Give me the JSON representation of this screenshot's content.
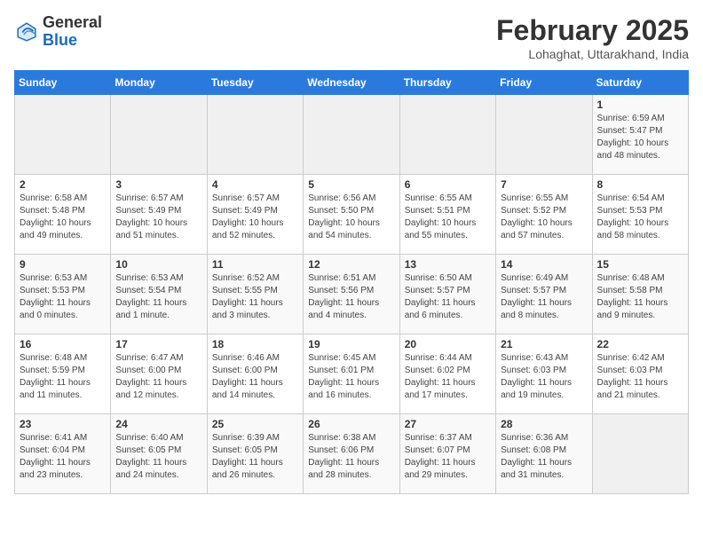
{
  "header": {
    "logo_line1": "General",
    "logo_line2": "Blue",
    "title": "February 2025",
    "subtitle": "Lohaghat, Uttarakhand, India"
  },
  "weekdays": [
    "Sunday",
    "Monday",
    "Tuesday",
    "Wednesday",
    "Thursday",
    "Friday",
    "Saturday"
  ],
  "weeks": [
    [
      {
        "day": "",
        "info": ""
      },
      {
        "day": "",
        "info": ""
      },
      {
        "day": "",
        "info": ""
      },
      {
        "day": "",
        "info": ""
      },
      {
        "day": "",
        "info": ""
      },
      {
        "day": "",
        "info": ""
      },
      {
        "day": "1",
        "info": "Sunrise: 6:59 AM\nSunset: 5:47 PM\nDaylight: 10 hours\nand 48 minutes."
      }
    ],
    [
      {
        "day": "2",
        "info": "Sunrise: 6:58 AM\nSunset: 5:48 PM\nDaylight: 10 hours\nand 49 minutes."
      },
      {
        "day": "3",
        "info": "Sunrise: 6:57 AM\nSunset: 5:49 PM\nDaylight: 10 hours\nand 51 minutes."
      },
      {
        "day": "4",
        "info": "Sunrise: 6:57 AM\nSunset: 5:49 PM\nDaylight: 10 hours\nand 52 minutes."
      },
      {
        "day": "5",
        "info": "Sunrise: 6:56 AM\nSunset: 5:50 PM\nDaylight: 10 hours\nand 54 minutes."
      },
      {
        "day": "6",
        "info": "Sunrise: 6:55 AM\nSunset: 5:51 PM\nDaylight: 10 hours\nand 55 minutes."
      },
      {
        "day": "7",
        "info": "Sunrise: 6:55 AM\nSunset: 5:52 PM\nDaylight: 10 hours\nand 57 minutes."
      },
      {
        "day": "8",
        "info": "Sunrise: 6:54 AM\nSunset: 5:53 PM\nDaylight: 10 hours\nand 58 minutes."
      }
    ],
    [
      {
        "day": "9",
        "info": "Sunrise: 6:53 AM\nSunset: 5:53 PM\nDaylight: 11 hours\nand 0 minutes."
      },
      {
        "day": "10",
        "info": "Sunrise: 6:53 AM\nSunset: 5:54 PM\nDaylight: 11 hours\nand 1 minute."
      },
      {
        "day": "11",
        "info": "Sunrise: 6:52 AM\nSunset: 5:55 PM\nDaylight: 11 hours\nand 3 minutes."
      },
      {
        "day": "12",
        "info": "Sunrise: 6:51 AM\nSunset: 5:56 PM\nDaylight: 11 hours\nand 4 minutes."
      },
      {
        "day": "13",
        "info": "Sunrise: 6:50 AM\nSunset: 5:57 PM\nDaylight: 11 hours\nand 6 minutes."
      },
      {
        "day": "14",
        "info": "Sunrise: 6:49 AM\nSunset: 5:57 PM\nDaylight: 11 hours\nand 8 minutes."
      },
      {
        "day": "15",
        "info": "Sunrise: 6:48 AM\nSunset: 5:58 PM\nDaylight: 11 hours\nand 9 minutes."
      }
    ],
    [
      {
        "day": "16",
        "info": "Sunrise: 6:48 AM\nSunset: 5:59 PM\nDaylight: 11 hours\nand 11 minutes."
      },
      {
        "day": "17",
        "info": "Sunrise: 6:47 AM\nSunset: 6:00 PM\nDaylight: 11 hours\nand 12 minutes."
      },
      {
        "day": "18",
        "info": "Sunrise: 6:46 AM\nSunset: 6:00 PM\nDaylight: 11 hours\nand 14 minutes."
      },
      {
        "day": "19",
        "info": "Sunrise: 6:45 AM\nSunset: 6:01 PM\nDaylight: 11 hours\nand 16 minutes."
      },
      {
        "day": "20",
        "info": "Sunrise: 6:44 AM\nSunset: 6:02 PM\nDaylight: 11 hours\nand 17 minutes."
      },
      {
        "day": "21",
        "info": "Sunrise: 6:43 AM\nSunset: 6:03 PM\nDaylight: 11 hours\nand 19 minutes."
      },
      {
        "day": "22",
        "info": "Sunrise: 6:42 AM\nSunset: 6:03 PM\nDaylight: 11 hours\nand 21 minutes."
      }
    ],
    [
      {
        "day": "23",
        "info": "Sunrise: 6:41 AM\nSunset: 6:04 PM\nDaylight: 11 hours\nand 23 minutes."
      },
      {
        "day": "24",
        "info": "Sunrise: 6:40 AM\nSunset: 6:05 PM\nDaylight: 11 hours\nand 24 minutes."
      },
      {
        "day": "25",
        "info": "Sunrise: 6:39 AM\nSunset: 6:05 PM\nDaylight: 11 hours\nand 26 minutes."
      },
      {
        "day": "26",
        "info": "Sunrise: 6:38 AM\nSunset: 6:06 PM\nDaylight: 11 hours\nand 28 minutes."
      },
      {
        "day": "27",
        "info": "Sunrise: 6:37 AM\nSunset: 6:07 PM\nDaylight: 11 hours\nand 29 minutes."
      },
      {
        "day": "28",
        "info": "Sunrise: 6:36 AM\nSunset: 6:08 PM\nDaylight: 11 hours\nand 31 minutes."
      },
      {
        "day": "",
        "info": ""
      }
    ]
  ]
}
